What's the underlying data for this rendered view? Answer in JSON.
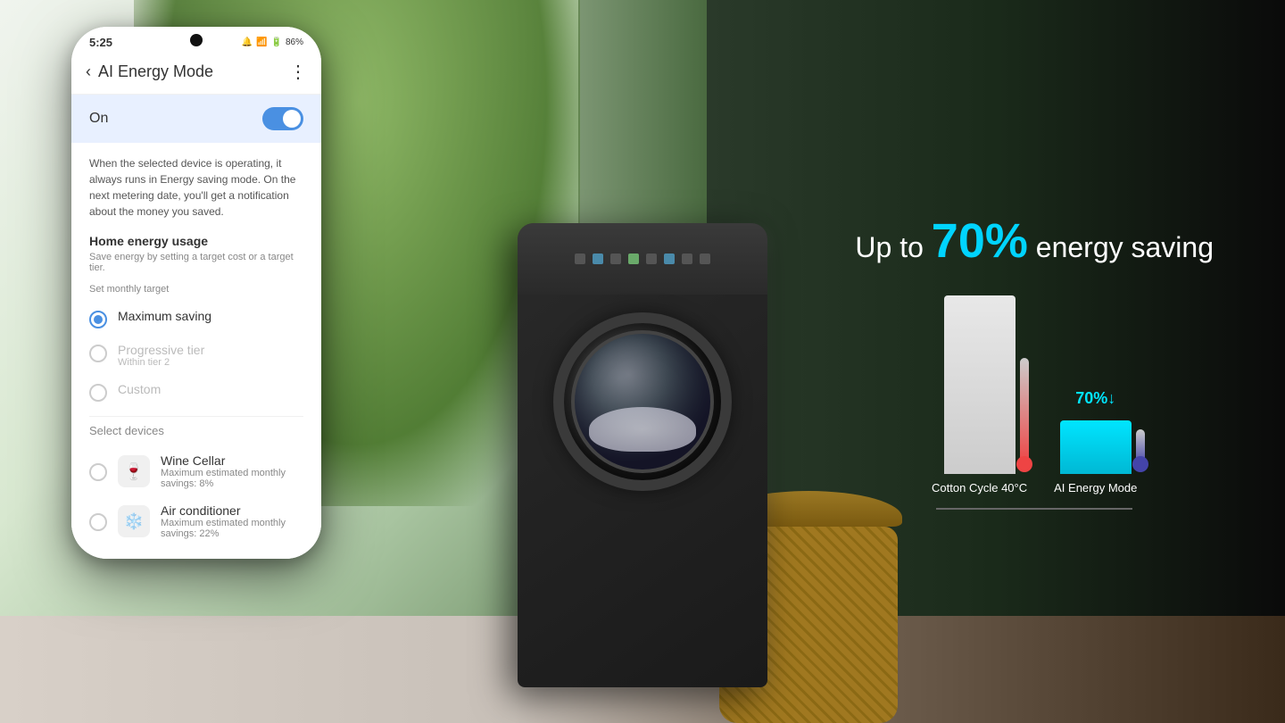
{
  "scene": {
    "energy_saving_prefix": "Up to",
    "energy_saving_percent": "70%",
    "energy_saving_suffix": "energy saving",
    "bar_cotton_label": "Cotton Cycle 40°C",
    "bar_ai_label": "AI Energy Mode",
    "bar_ai_percent": "70%↓",
    "connection_line_visible": true
  },
  "phone": {
    "status_bar": {
      "time": "5:25",
      "icons": "🔋 86%"
    },
    "header": {
      "back_label": "‹",
      "title": "AI Energy Mode",
      "more_label": "⋮"
    },
    "toggle": {
      "label": "On",
      "state": "on"
    },
    "description": "When the selected device is operating, it always runs in Energy saving mode. On the next metering date, you'll get a notification about the money you saved.",
    "home_energy": {
      "title": "Home energy usage",
      "subtitle": "Save energy by setting a target cost or a target tier."
    },
    "set_monthly_target": {
      "label": "Set monthly target",
      "options": [
        {
          "id": "maximum_saving",
          "label": "Maximum saving",
          "sub": "",
          "selected": true,
          "disabled": false
        },
        {
          "id": "progressive_tier",
          "label": "Progressive tier",
          "sub": "Within tier 2",
          "selected": false,
          "disabled": true
        },
        {
          "id": "custom",
          "label": "Custom",
          "sub": "",
          "selected": false,
          "disabled": true
        }
      ]
    },
    "select_devices": {
      "label": "Select devices",
      "devices": [
        {
          "id": "wine_cellar",
          "name": "Wine Cellar",
          "savings": "Maximum estimated monthly savings: 8%",
          "icon": "🍷"
        },
        {
          "id": "air_conditioner",
          "name": "Air conditioner",
          "savings": "Maximum estimated monthly savings: 22%",
          "icon": "❄️"
        }
      ]
    }
  }
}
